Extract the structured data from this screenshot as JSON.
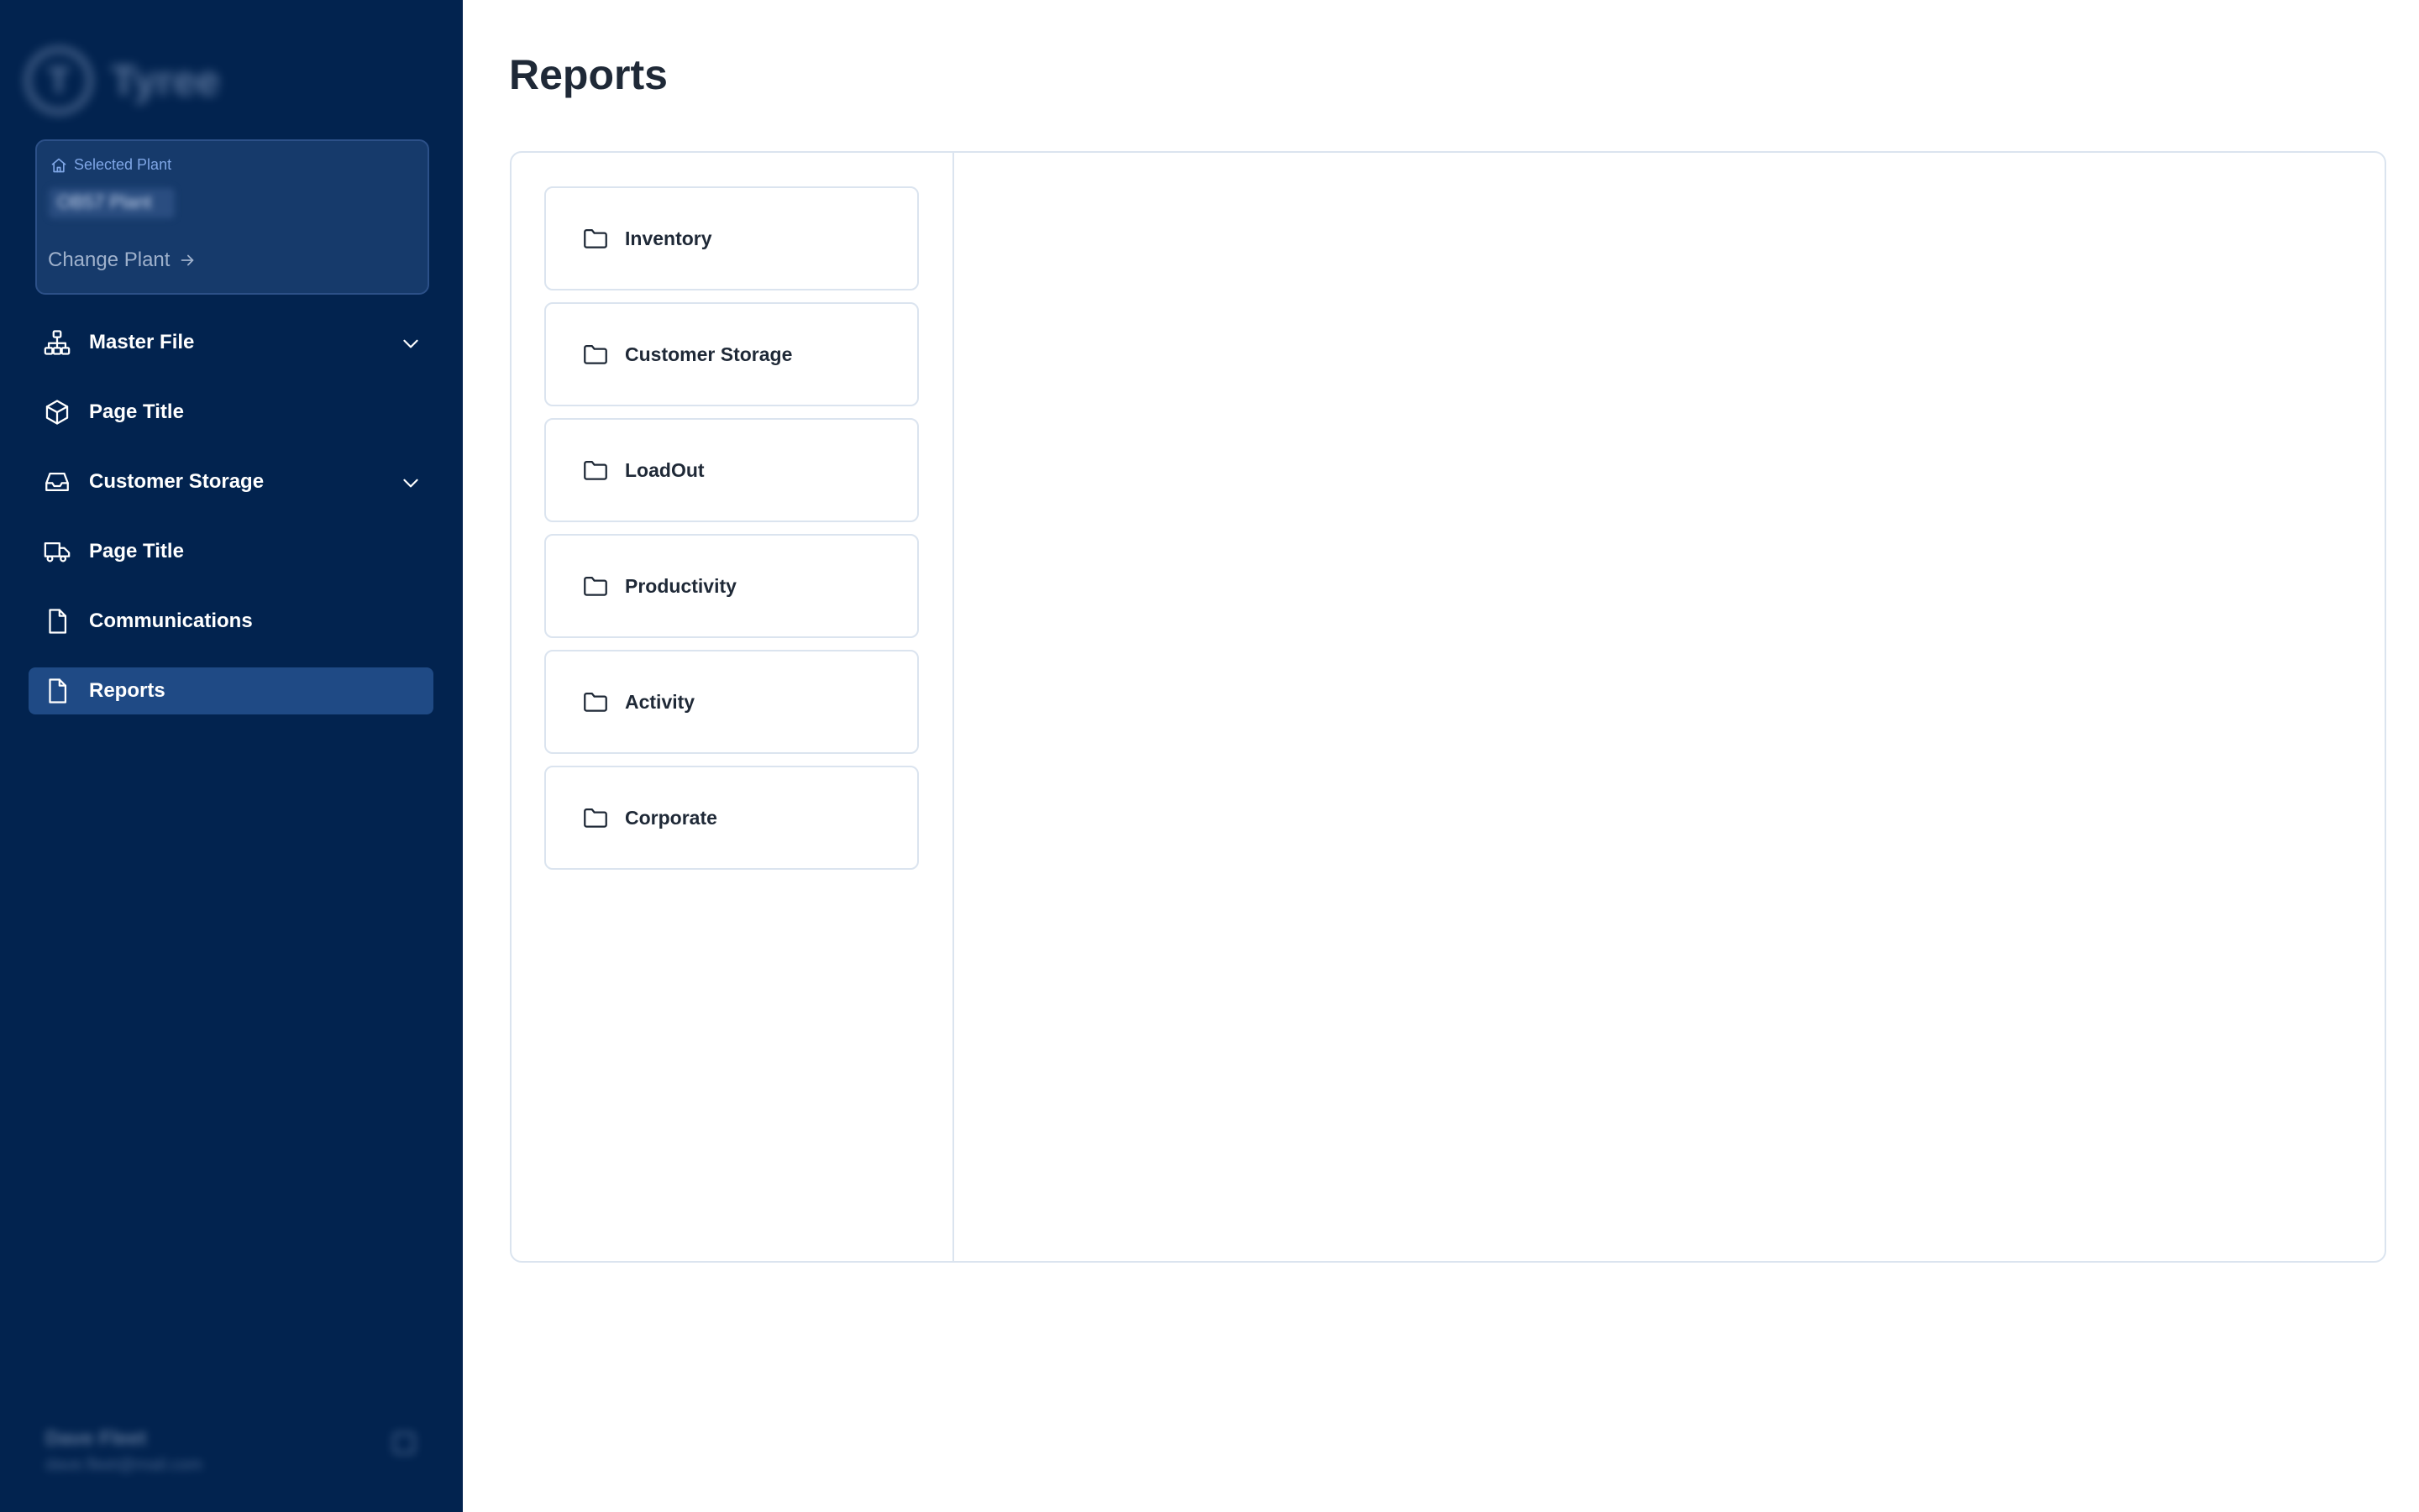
{
  "sidebar": {
    "brand": {
      "mark": "T",
      "name": "Tyree",
      "icon": "logo-icon"
    },
    "plant": {
      "label": "Selected Plant",
      "name": "OB57 Plant",
      "change_label": "Change Plant",
      "label_icon": "home-icon",
      "change_icon": "arrow-right-icon"
    },
    "nav": [
      {
        "label": "Master File",
        "icon": "sitemap-icon",
        "expandable": true
      },
      {
        "label": "Page Title",
        "icon": "cube-icon",
        "expandable": false
      },
      {
        "label": "Customer Storage",
        "icon": "inbox-icon",
        "expandable": true
      },
      {
        "label": "Page Title",
        "icon": "truck-icon",
        "expandable": false
      },
      {
        "label": "Communications",
        "icon": "document-icon",
        "expandable": false
      },
      {
        "label": "Reports",
        "icon": "document-icon",
        "expandable": false,
        "active": true
      }
    ],
    "user": {
      "name": "Dave Fleet",
      "email": "dave.fleet@mail.com"
    }
  },
  "main": {
    "title": "Reports",
    "folders": [
      {
        "label": "Inventory",
        "icon": "folder-icon"
      },
      {
        "label": "Customer Storage",
        "icon": "folder-icon"
      },
      {
        "label": "LoadOut",
        "icon": "folder-icon"
      },
      {
        "label": "Productivity",
        "icon": "folder-icon"
      },
      {
        "label": "Activity",
        "icon": "folder-icon"
      },
      {
        "label": "Corporate",
        "icon": "folder-icon"
      }
    ]
  },
  "colors": {
    "sidebar_bg": "#02234f",
    "active_item_bg": "#1f4a85",
    "plant_card_bg": "#163a6b",
    "accent": "#7fa6e6",
    "border": "#dbe4ef"
  }
}
